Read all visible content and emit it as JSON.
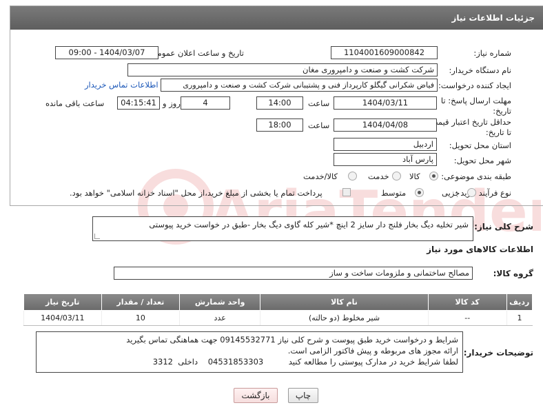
{
  "header": {
    "title": "جزئیات اطلاعات نیاز"
  },
  "fields": {
    "need_number_label": "شماره نیاز:",
    "need_number": "1104001609000842",
    "announce_label": "تاریخ و ساعت اعلان عمومی:",
    "announce_value": "1404/03/07 - 09:00",
    "buyer_org_label": "نام دستگاه خریدار:",
    "buyer_org": "شرکت کشت و صنعت و دامپروری مغان",
    "requester_label": "ایجاد کننده درخواست:",
    "requester": "فیاض شکرانی گیگلو کارپرداز فنی و پشتیبانی شرکت کشت و صنعت و دامپروری",
    "contact_link": "اطلاعات تماس خریدار",
    "reply_deadline_label_1": "مهلت ارسال پاسخ: تا",
    "reply_deadline_label_2": "تاریخ:",
    "reply_date": "1404/03/11",
    "time_label": "ساعت",
    "reply_time": "14:00",
    "days": "4",
    "days_label": "روز و",
    "remaining_time": "04:15:41",
    "remaining_label": "ساعت باقی مانده",
    "price_validity_label_1": "حداقل تاریخ اعتبار قیمت:",
    "price_validity_label_2": "تا تاریخ:",
    "price_date": "1404/04/08",
    "price_time": "18:00",
    "province_label": "استان محل تحویل:",
    "province": "اردبیل",
    "city_label": "شهر محل تحویل:",
    "city": "پارس آباد",
    "category_label": "طبقه بندی موضوعی:",
    "category_options": [
      "کالا",
      "خدمت",
      "کالا/خدمت"
    ],
    "purchase_type_label": "نوع فرآیند خرید :",
    "purchase_options": [
      "جزیی",
      "متوسط"
    ],
    "payment_note": "پرداخت تمام یا بخشی از مبلغ خرید،از محل \"اسناد خزانه اسلامی\" خواهد بود."
  },
  "description": {
    "label": "شرح کلی نیاز:",
    "text": "شیر تخلیه دیگ بخار فلنج دار سایز 2 اینچ *شیر کله گاوی دیگ بخار -طبق در خواست خرید پیوستی"
  },
  "goods": {
    "section_title": "اطلاعات کالاهای مورد نیاز",
    "group_label": "گروه کالا:",
    "group_value": "مصالح ساختمانی و ملزومات ساخت و ساز",
    "columns": [
      "ردیف",
      "کد کالا",
      "نام کالا",
      "واحد شمارش",
      "تعداد / مقدار",
      "تاریخ نیاز"
    ],
    "rows": [
      [
        "1",
        "--",
        "شیر مخلوط (دو حالته)",
        "عدد",
        "10",
        "1404/03/11"
      ]
    ]
  },
  "buyer_notes": {
    "label": "توضیحات خریدار:",
    "lines": [
      "شرایط و درخواست خرید طبق پیوست و شرح کلی نیاز 09145532771 جهت هماهنگی تماس بگیرید",
      "ارائه مجوز های مربوطه و پیش فاکتور الزامی است.",
      "لطفا شرایط خرید در مدارک پیوستی را مطالعه کنید          04531853303    داخلی  3312"
    ]
  },
  "buttons": {
    "print": "چاپ",
    "back": "بازگشت"
  },
  "watermark": {
    "text": "AriaTender.neT"
  }
}
